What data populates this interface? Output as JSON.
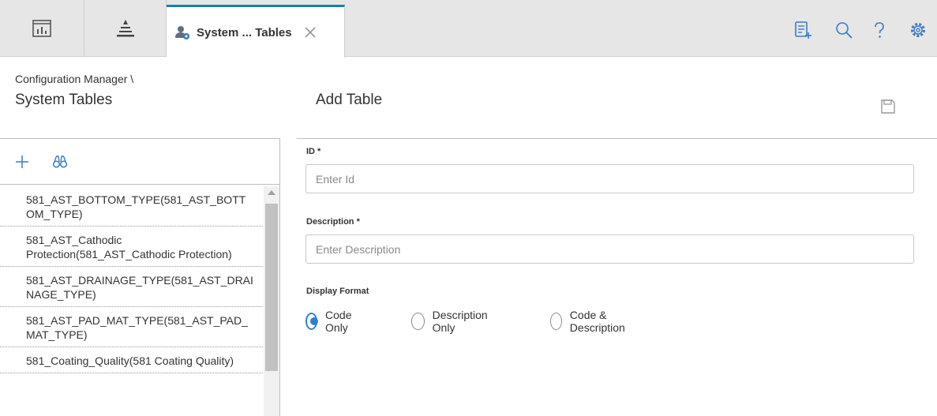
{
  "tabs": {
    "dashboard_icon": "dashboard-icon",
    "hierarchy_icon": "hierarchy-icon",
    "active": {
      "title": "System ... Tables",
      "icon": "user-settings-icon"
    }
  },
  "top_actions": [
    "add-note-icon",
    "search-icon",
    "help-icon",
    "gear-icon"
  ],
  "breadcrumb": "Configuration Manager \\",
  "left": {
    "title": "System Tables",
    "items": [
      "581_AST_BOTTOM_TYPE(581_AST_BOTTOM_TYPE)",
      "581_AST_Cathodic Protection(581_AST_Cathodic Protection)",
      "581_AST_DRAINAGE_TYPE(581_AST_DRAINAGE_TYPE)",
      "581_AST_PAD_MAT_TYPE(581_AST_PAD_MAT_TYPE)",
      "581_Coating_Quality(581 Coating Quality)"
    ]
  },
  "form": {
    "title": "Add Table",
    "id_label": "ID *",
    "id_placeholder": "Enter Id",
    "desc_label": "Description *",
    "desc_placeholder": "Enter Description",
    "format_label": "Display Format",
    "options": [
      {
        "label": "Code Only",
        "checked": true
      },
      {
        "label": "Description Only",
        "checked": false
      },
      {
        "label": "Code & Description",
        "checked": false
      }
    ]
  },
  "colors": {
    "accent": "#1b7fa6",
    "radio": "#2f7fd0",
    "icon": "#3a7bc8"
  }
}
